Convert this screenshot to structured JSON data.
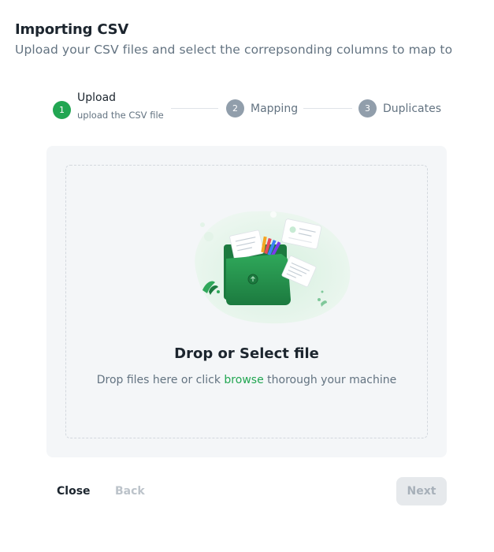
{
  "dialog": {
    "title": "Importing CSV",
    "subtitle": "Upload your CSV files and select the correpsonding columns to map to"
  },
  "stepper": {
    "steps": [
      {
        "number": "1",
        "label": "Upload",
        "caption": "upload the CSV file",
        "state": "active"
      },
      {
        "number": "2",
        "label": "Mapping",
        "state": "inactive"
      },
      {
        "number": "3",
        "label": "Duplicates",
        "state": "inactive"
      }
    ]
  },
  "dropzone": {
    "title": "Drop or Select file",
    "description_before": "Drop files here or click ",
    "browse_label": "browse",
    "description_after": " thorough your machine"
  },
  "footer": {
    "close_label": "Close",
    "back_label": "Back",
    "next_label": "Next"
  },
  "colors": {
    "accent": "#22a652",
    "inactive_step": "#919eab",
    "panel_background": "#f4f6f8"
  },
  "icons": [
    "folder-upload-illustration"
  ]
}
